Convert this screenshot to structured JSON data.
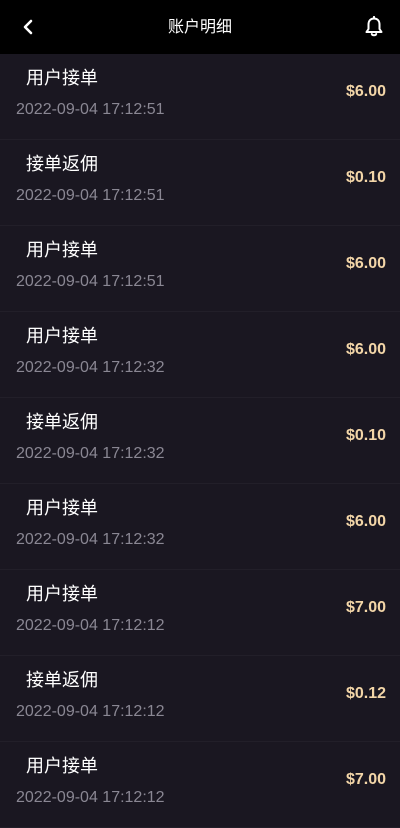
{
  "header": {
    "title": "账户明细",
    "back_icon": "chevron-left-icon",
    "right_icon": "bell-icon"
  },
  "colors": {
    "header_bg": "#000000",
    "page_bg": "#1a1721",
    "amount": "#f3d6a8",
    "time": "#8a8793",
    "title": "#ffffff"
  },
  "records": [
    {
      "title": "用户接单",
      "time": "2022-09-04 17:12:51",
      "amount": "$6.00"
    },
    {
      "title": "接单返佣",
      "time": "2022-09-04 17:12:51",
      "amount": "$0.10"
    },
    {
      "title": "用户接单",
      "time": "2022-09-04 17:12:51",
      "amount": "$6.00"
    },
    {
      "title": "用户接单",
      "time": "2022-09-04 17:12:32",
      "amount": "$6.00"
    },
    {
      "title": "接单返佣",
      "time": "2022-09-04 17:12:32",
      "amount": "$0.10"
    },
    {
      "title": "用户接单",
      "time": "2022-09-04 17:12:32",
      "amount": "$6.00"
    },
    {
      "title": "用户接单",
      "time": "2022-09-04 17:12:12",
      "amount": "$7.00"
    },
    {
      "title": "接单返佣",
      "time": "2022-09-04 17:12:12",
      "amount": "$0.12"
    },
    {
      "title": "用户接单",
      "time": "2022-09-04 17:12:12",
      "amount": "$7.00"
    }
  ]
}
